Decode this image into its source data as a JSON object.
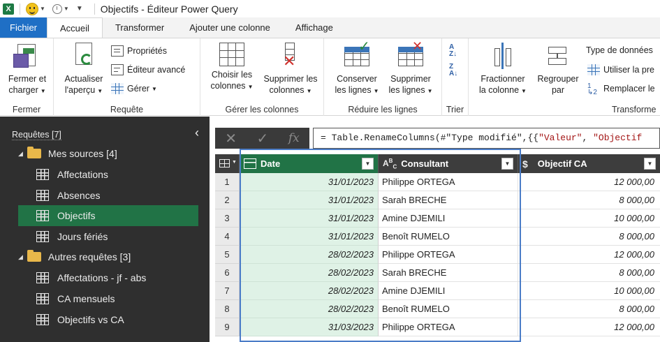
{
  "window": {
    "app_icon": "excel-icon",
    "title": "Objectifs - Éditeur Power Query"
  },
  "tabs": [
    {
      "label": "Fichier"
    },
    {
      "label": "Accueil"
    },
    {
      "label": "Transformer"
    },
    {
      "label": "Ajouter une colonne"
    },
    {
      "label": "Affichage"
    }
  ],
  "ribbon": {
    "fermer": {
      "btn_line1": "Fermer et",
      "btn_line2": "charger",
      "group": "Fermer"
    },
    "requete": {
      "actualiser_line1": "Actualiser",
      "actualiser_line2": "l'aperçu",
      "proprietes": "Propriétés",
      "editeur": "Éditeur avancé",
      "gerer": "Gérer",
      "group": "Requête"
    },
    "colonnes": {
      "choisir_line1": "Choisir les",
      "choisir_line2": "colonnes",
      "supprimer_line1": "Supprimer les",
      "supprimer_line2": "colonnes",
      "group": "Gérer les colonnes"
    },
    "lignes": {
      "conserver_line1": "Conserver",
      "conserver_line2": "les lignes",
      "supprimer_line1": "Supprimer",
      "supprimer_line2": "les lignes",
      "group": "Réduire les lignes"
    },
    "trier": {
      "group": "Trier"
    },
    "transformer": {
      "fractionner_line1": "Fractionner",
      "fractionner_line2": "la colonne",
      "regrouper_line1": "Regrouper",
      "regrouper_line2": "par",
      "type": "Type de données",
      "premiere": "Utiliser la pre",
      "remplacer": "Remplacer le",
      "group": "Transforme"
    }
  },
  "queries": {
    "header": "Requêtes [7]",
    "folder1": "Mes sources [4]",
    "items1": [
      {
        "label": "Affectations"
      },
      {
        "label": "Absences"
      },
      {
        "label": "Objectifs"
      },
      {
        "label": "Jours fériés"
      }
    ],
    "folder2": "Autres requêtes [3]",
    "items2": [
      {
        "label": "Affectations - jf - abs"
      },
      {
        "label": "CA mensuels"
      },
      {
        "label": "Objectifs vs CA"
      }
    ]
  },
  "formula": {
    "prefix": "= Table.RenameColumns(#\"Type modifié\",{{",
    "str1": "\"Valeur\"",
    "mid": ", ",
    "str2": "\"Objectif"
  },
  "table": {
    "columns": [
      {
        "type_icon": "calendar-icon",
        "name": "Date"
      },
      {
        "type_icon": "text-type-icon",
        "name": "Consultant"
      },
      {
        "type_icon": "currency-icon",
        "name": "Objectif CA"
      }
    ],
    "rows": [
      {
        "n": "1",
        "date": "31/01/2023",
        "consultant": "Philippe ORTEGA",
        "objectif": "12 000,00"
      },
      {
        "n": "2",
        "date": "31/01/2023",
        "consultant": "Sarah BRECHE",
        "objectif": "8 000,00"
      },
      {
        "n": "3",
        "date": "31/01/2023",
        "consultant": "Amine DJEMILI",
        "objectif": "10 000,00"
      },
      {
        "n": "4",
        "date": "31/01/2023",
        "consultant": "Benoît RUMELO",
        "objectif": "8 000,00"
      },
      {
        "n": "5",
        "date": "28/02/2023",
        "consultant": "Philippe ORTEGA",
        "objectif": "12 000,00"
      },
      {
        "n": "6",
        "date": "28/02/2023",
        "consultant": "Sarah BRECHE",
        "objectif": "8 000,00"
      },
      {
        "n": "7",
        "date": "28/02/2023",
        "consultant": "Amine DJEMILI",
        "objectif": "10 000,00"
      },
      {
        "n": "8",
        "date": "28/02/2023",
        "consultant": "Benoît RUMELO",
        "objectif": "8 000,00"
      },
      {
        "n": "9",
        "date": "31/03/2023",
        "consultant": "Philippe ORTEGA",
        "objectif": "12 000,00"
      }
    ]
  },
  "colors": {
    "accent_green": "#217346",
    "file_tab_blue": "#1f6fc5",
    "pane_dark": "#2f2f2f"
  }
}
